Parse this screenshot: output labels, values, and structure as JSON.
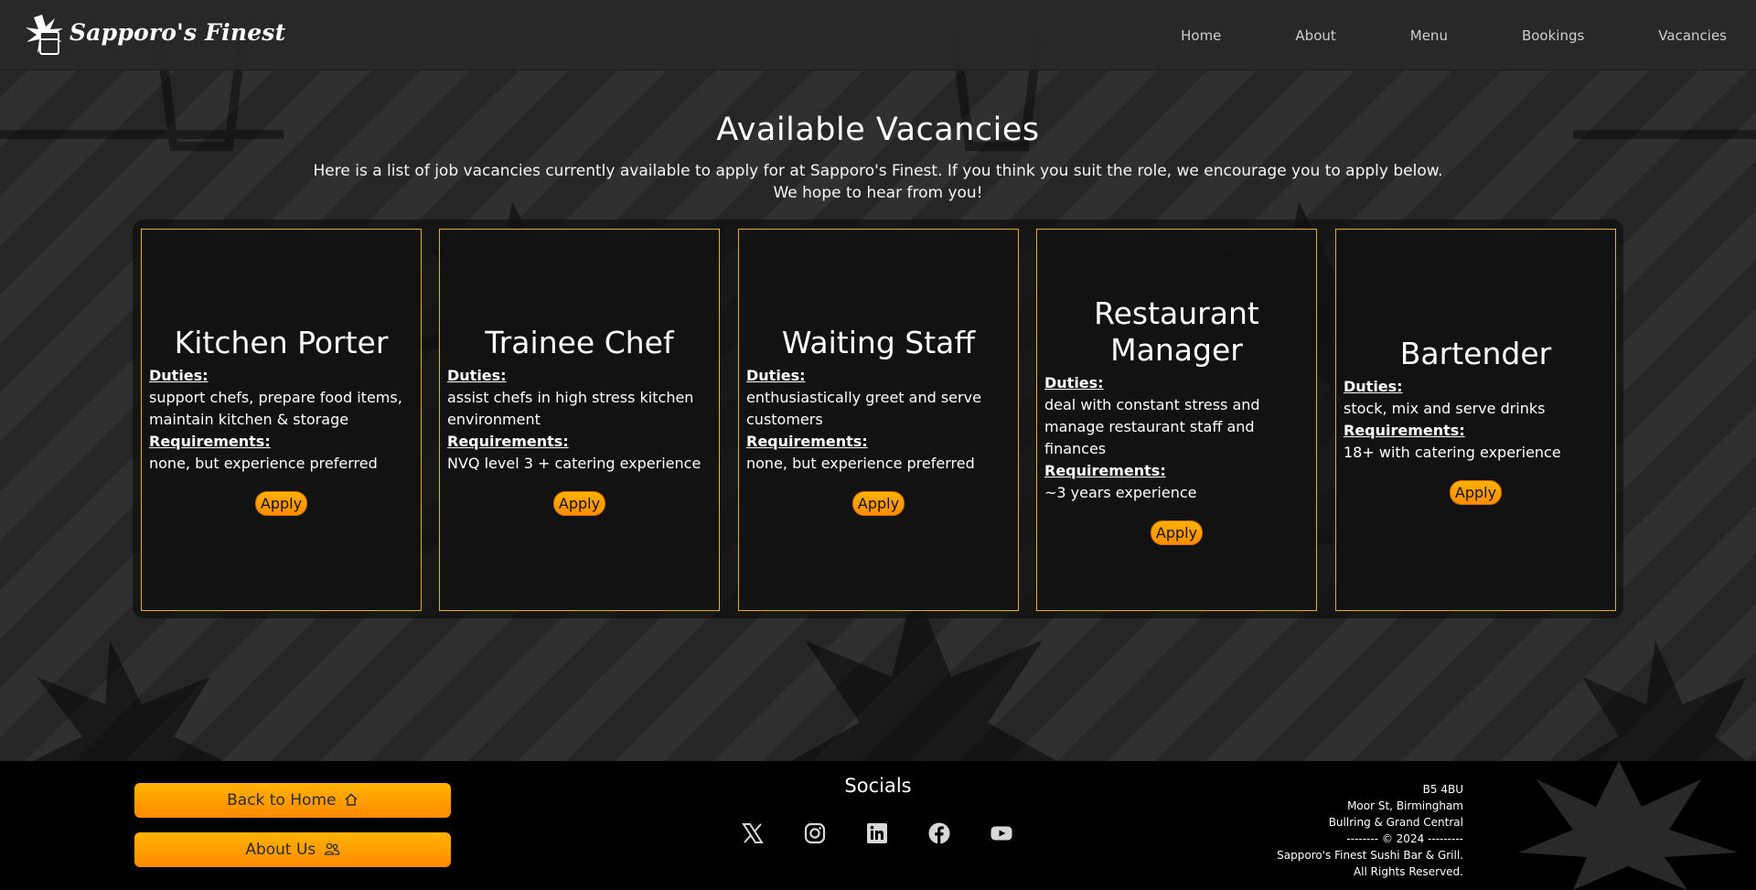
{
  "brand": {
    "name": "Sapporo's Finest",
    "accent": "#ffa000",
    "card_border": "#e0b21d"
  },
  "nav": [
    {
      "label": "Home"
    },
    {
      "label": "About"
    },
    {
      "label": "Menu"
    },
    {
      "label": "Bookings"
    },
    {
      "label": "Vacancies"
    }
  ],
  "main": {
    "title": "Available Vacancies",
    "intro_line1": "Here is a list of job vacancies currently available to apply for at Sapporo's Finest. If you think you suit the role, we encourage you to apply below.",
    "intro_line2": "We hope to hear from you!"
  },
  "vacancies": [
    {
      "title": "Kitchen Porter",
      "duties_label": "Duties:",
      "duties": "support chefs, prepare food items, maintain kitchen & storage",
      "req_label": "Requirements:",
      "requirements": "none, but experience preferred",
      "apply": "Apply"
    },
    {
      "title": "Trainee Chef",
      "duties_label": "Duties:",
      "duties": "assist chefs in high stress kitchen environment",
      "req_label": "Requirements:",
      "requirements": "NVQ level 3 + catering experience",
      "apply": "Apply"
    },
    {
      "title": "Waiting Staff",
      "duties_label": "Duties:",
      "duties": "enthusiastically greet and serve customers",
      "req_label": "Requirements:",
      "requirements": "none, but experience preferred",
      "apply": "Apply"
    },
    {
      "title": "Restaurant Manager",
      "duties_label": "Duties:",
      "duties": "deal with constant stress and manage restaurant staff and finances",
      "req_label": "Requirements:",
      "requirements": "~3 years experience",
      "apply": "Apply"
    },
    {
      "title": "Bartender",
      "duties_label": "Duties:",
      "duties": "stock, mix and serve drinks",
      "req_label": "Requirements:",
      "requirements": "18+ with catering experience",
      "apply": "Apply"
    }
  ],
  "footer": {
    "back_home": "Back to Home",
    "about_us": "About Us",
    "socials_title": "Socials",
    "socials": [
      {
        "icon": "x-twitter-icon"
      },
      {
        "icon": "instagram-icon"
      },
      {
        "icon": "linkedin-icon"
      },
      {
        "icon": "facebook-icon"
      },
      {
        "icon": "youtube-icon"
      }
    ],
    "address_lines": [
      "B5 4BU",
      "Moor St, Birmingham",
      "Bullring & Grand Central",
      "-------- © 2024 ---------",
      "Sapporo's Finest Sushi Bar & Grill.",
      "All Rights Reserved."
    ]
  }
}
